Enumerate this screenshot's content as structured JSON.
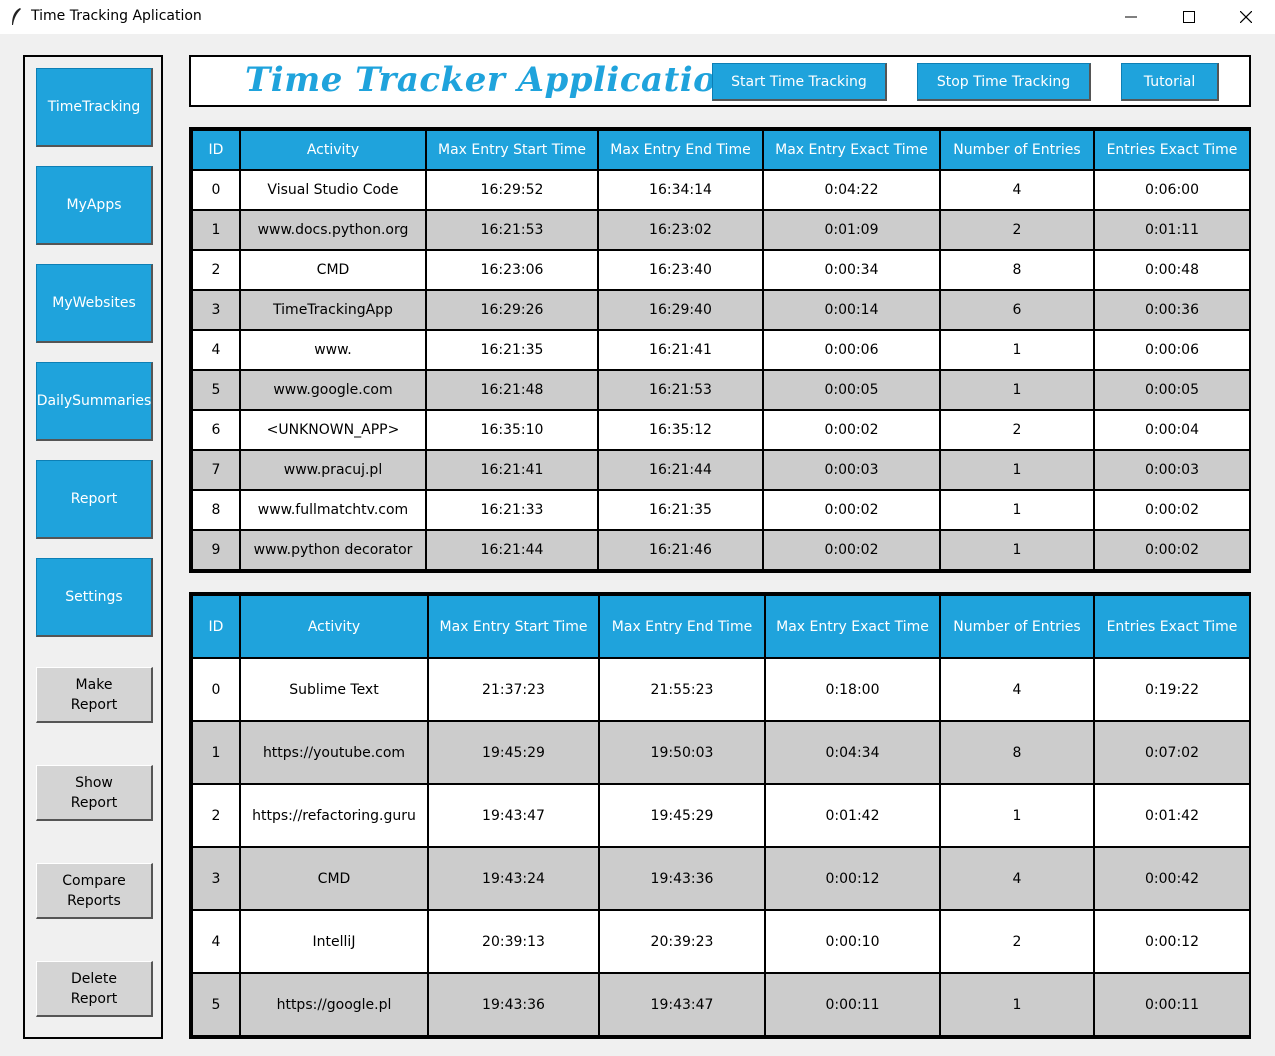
{
  "window": {
    "title": "Time Tracking Aplication"
  },
  "sidebar": {
    "nav": [
      "TimeTracking",
      "MyApps",
      "MyWebsites",
      "DailySummaries",
      "Report",
      "Settings"
    ],
    "report_buttons": [
      "Make\nReport",
      "Show\nReport",
      "Compare\nReports",
      "Delete\nReport"
    ]
  },
  "header": {
    "brand": "Time Tracker Application",
    "start_label": "Start Time Tracking",
    "stop_label": "Stop Time Tracking",
    "tutorial_label": "Tutorial"
  },
  "colors": {
    "accent": "#1fa3dc",
    "row_alt": "#cccccc"
  },
  "table1": {
    "columns": [
      "ID",
      "Activity",
      "Max Entry Start Time",
      "Max Entry End Time",
      "Max Entry Exact Time",
      "Number of Entries",
      "Entries Exact Time"
    ],
    "rows": [
      [
        "0",
        "Visual Studio Code",
        "16:29:52",
        "16:34:14",
        "0:04:22",
        "4",
        "0:06:00"
      ],
      [
        "1",
        "www.docs.python.org",
        "16:21:53",
        "16:23:02",
        "0:01:09",
        "2",
        "0:01:11"
      ],
      [
        "2",
        "CMD",
        "16:23:06",
        "16:23:40",
        "0:00:34",
        "8",
        "0:00:48"
      ],
      [
        "3",
        "TimeTrackingApp",
        "16:29:26",
        "16:29:40",
        "0:00:14",
        "6",
        "0:00:36"
      ],
      [
        "4",
        "www.",
        "16:21:35",
        "16:21:41",
        "0:00:06",
        "1",
        "0:00:06"
      ],
      [
        "5",
        "www.google.com",
        "16:21:48",
        "16:21:53",
        "0:00:05",
        "1",
        "0:00:05"
      ],
      [
        "6",
        "<UNKNOWN_APP>",
        "16:35:10",
        "16:35:12",
        "0:00:02",
        "2",
        "0:00:04"
      ],
      [
        "7",
        "www.pracuj.pl",
        "16:21:41",
        "16:21:44",
        "0:00:03",
        "1",
        "0:00:03"
      ],
      [
        "8",
        "www.fullmatchtv.com",
        "16:21:33",
        "16:21:35",
        "0:00:02",
        "1",
        "0:00:02"
      ],
      [
        "9",
        "www.python decorator",
        "16:21:44",
        "16:21:46",
        "0:00:02",
        "1",
        "0:00:02"
      ]
    ]
  },
  "table2": {
    "columns": [
      "ID",
      "Activity",
      "Max Entry Start Time",
      "Max Entry End Time",
      "Max Entry Exact Time",
      "Number of Entries",
      "Entries Exact Time"
    ],
    "rows": [
      [
        "0",
        "Sublime Text",
        "21:37:23",
        "21:55:23",
        "0:18:00",
        "4",
        "0:19:22"
      ],
      [
        "1",
        "https://youtube.com",
        "19:45:29",
        "19:50:03",
        "0:04:34",
        "8",
        "0:07:02"
      ],
      [
        "2",
        "https://refactoring.guru",
        "19:43:47",
        "19:45:29",
        "0:01:42",
        "1",
        "0:01:42"
      ],
      [
        "3",
        "CMD",
        "19:43:24",
        "19:43:36",
        "0:00:12",
        "4",
        "0:00:42"
      ],
      [
        "4",
        "IntelliJ",
        "20:39:13",
        "20:39:23",
        "0:00:10",
        "2",
        "0:00:12"
      ],
      [
        "5",
        "https://google.pl",
        "19:43:36",
        "19:43:47",
        "0:00:11",
        "1",
        "0:00:11"
      ]
    ]
  }
}
